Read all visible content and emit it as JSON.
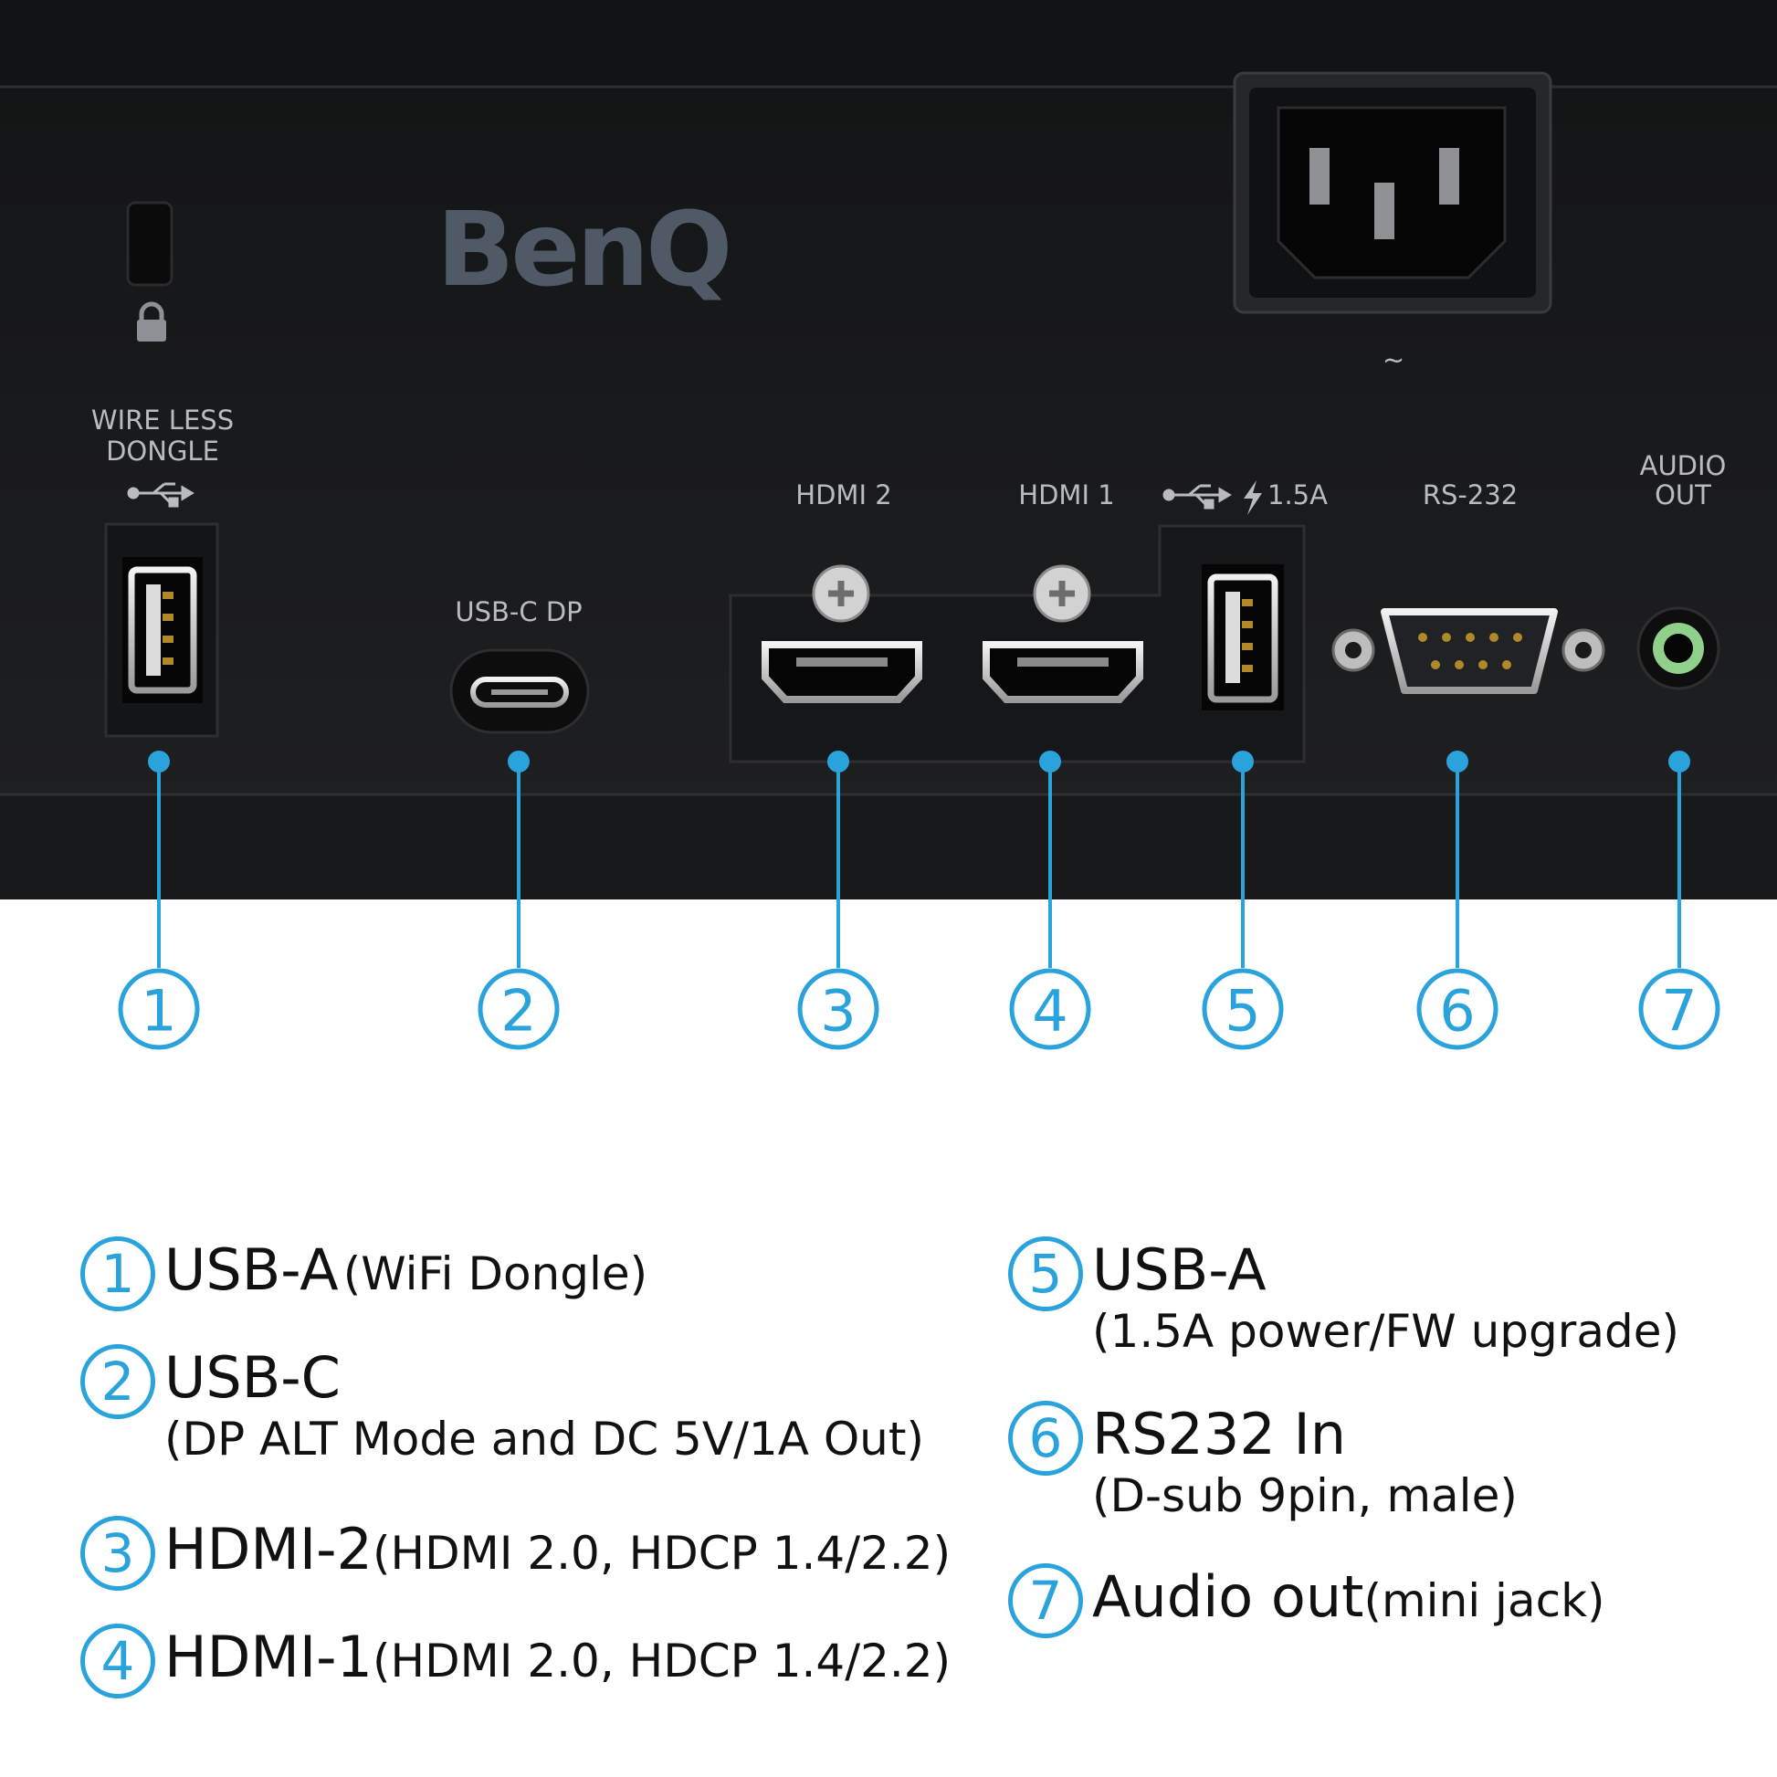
{
  "panel": {
    "brand": "BenQ",
    "power_symbol": "~",
    "port_labels": {
      "wireless_dongle_line1": "WIRE LESS",
      "wireless_dongle_line2": "DONGLE",
      "usbc_dp": "USB-C DP",
      "hdmi2": "HDMI 2",
      "hdmi1": "HDMI 1",
      "usb_power": "1.5A",
      "rs232": "RS-232",
      "audio_out_line1": "AUDIO",
      "audio_out_line2": "OUT"
    }
  },
  "callouts": [
    "1",
    "2",
    "3",
    "4",
    "5",
    "6",
    "7"
  ],
  "legend": [
    {
      "num": "1",
      "main": "USB-A",
      "sub": "(WiFi Dongle)"
    },
    {
      "num": "2",
      "main": "USB-C",
      "sub": "(DP ALT Mode and DC 5V/1A Out)"
    },
    {
      "num": "3",
      "main": "HDMI-2",
      "sub": "(HDMI 2.0, HDCP 1.4/2.2)"
    },
    {
      "num": "4",
      "main": "HDMI-1",
      "sub": "(HDMI 2.0, HDCP 1.4/2.2)"
    },
    {
      "num": "5",
      "main": "USB-A",
      "sub": "(1.5A power/FW upgrade)"
    },
    {
      "num": "6",
      "main": "RS232 In",
      "sub": "(D-sub 9pin, male)"
    },
    {
      "num": "7",
      "main": "Audio out",
      "sub": "(mini jack)"
    }
  ],
  "colors": {
    "accent": "#2aa3dc",
    "panel": "#1b1c1e"
  }
}
